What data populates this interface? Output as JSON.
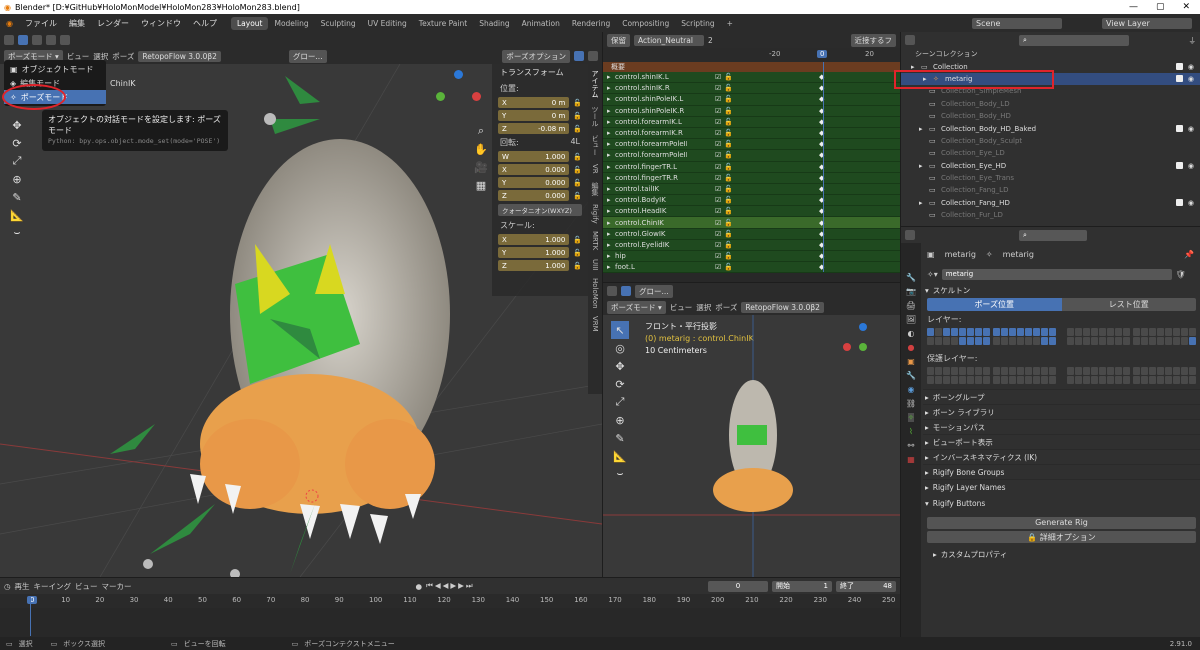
{
  "window": {
    "title": "Blender* [D:¥GitHub¥HoloMonModel¥HoloMon283¥HoloMon283.blend]"
  },
  "menu": {
    "items": [
      "ファイル",
      "編集",
      "レンダー",
      "ウィンドウ",
      "ヘルプ"
    ]
  },
  "workspaces": [
    "Layout",
    "Modeling",
    "Sculpting",
    "UV Editing",
    "Texture Paint",
    "Shading",
    "Animation",
    "Rendering",
    "Compositing",
    "Scripting"
  ],
  "scene": {
    "label": "Scene",
    "view_layer": "View Layer"
  },
  "viewport_header": {
    "mode": "ポーズモード",
    "view": "ビュー",
    "select": "選択",
    "pose": "ポーズ",
    "addon": "RetopoFlow 3.0.0β2",
    "transform": "グロー...",
    "pose_options": "ポーズオプション"
  },
  "mode_menu": {
    "items": [
      "オブジェクトモード",
      "編集モード",
      "ポーズモード"
    ],
    "bone": "ChinIK"
  },
  "tooltip": {
    "title": "オブジェクトの対話モードを設定します: ポーズモード",
    "python": "Python: bpy.ops.object.mode_set(mode='POSE')"
  },
  "npanel": {
    "header": "トランスフォーム",
    "location_label": "位置:",
    "loc": [
      [
        "X",
        "0 m"
      ],
      [
        "Y",
        "0 m"
      ],
      [
        "Z",
        "-0.08 m"
      ]
    ],
    "rotation_label": "回転:",
    "rot_mode_short": "4L",
    "rot": [
      [
        "W",
        "1.000"
      ],
      [
        "X",
        "0.000"
      ],
      [
        "Y",
        "0.000"
      ],
      [
        "Z",
        "0.000"
      ]
    ],
    "rot_mode": "クォータニオン(WXYZ)",
    "scale_label": "スケール:",
    "scale": [
      [
        "X",
        "1.000"
      ],
      [
        "Y",
        "1.000"
      ],
      [
        "Z",
        "1.000"
      ]
    ],
    "tabs": [
      "アイテム",
      "ツール",
      "ビュー",
      "VR",
      "編集",
      "Rigify",
      "MRTK",
      "UIII",
      "HoloMon",
      "VRM"
    ]
  },
  "action_editor": {
    "mode": "保留",
    "action": "Action_Neutral",
    "users": "2",
    "frame_ticks": [
      "-20",
      "0",
      "20"
    ],
    "filter_label": "近接するフ",
    "summary": "概要",
    "channels": [
      "control.shinIK.L",
      "control.shinIK.R",
      "control.shinPoleIK.L",
      "control.shinPoleIK.R",
      "control.forearmIK.L",
      "control.forearmIK.R",
      "control.forearmPoleIK.L",
      "control.forearmPoleIK.R",
      "control.fingerTR.L",
      "control.fingerTR.R",
      "control.tailIK",
      "control.BodyIK",
      "control.HeadIK",
      "control.ChinIK",
      "control.GlowIK",
      "control.EyelidIK",
      "hip",
      "foot.L"
    ]
  },
  "sub_viewport": {
    "view_name": "フロント・平行投影",
    "object": "(0) metarig : control.ChinIK",
    "scale": "10 Centimeters"
  },
  "outliner": {
    "root": "シーンコレクション",
    "items": [
      {
        "name": "Collection",
        "dim": false
      },
      {
        "name": "metarig",
        "dim": false,
        "selected": true
      },
      {
        "name": "Collection_SimpleMesh",
        "dim": true
      },
      {
        "name": "Collection_Body_LD",
        "dim": true
      },
      {
        "name": "Collection_Body_HD",
        "dim": true
      },
      {
        "name": "Collection_Body_HD_Baked",
        "dim": false
      },
      {
        "name": "Collection_Body_Sculpt",
        "dim": true
      },
      {
        "name": "Collection_Eye_LD",
        "dim": true
      },
      {
        "name": "Collection_Eye_HD",
        "dim": false
      },
      {
        "name": "Collection_Eye_Trans",
        "dim": true
      },
      {
        "name": "Collection_Fang_LD",
        "dim": true
      },
      {
        "name": "Collection_Fang_HD",
        "dim": false
      },
      {
        "name": "Collection_Fur_LD",
        "dim": true
      }
    ]
  },
  "properties": {
    "object": "metarig",
    "data": "metarig",
    "datablock": "metarig",
    "skeleton": "スケルトン",
    "pose_position": "ポーズ位置",
    "rest_position": "レスト位置",
    "layers_label": "レイヤー:",
    "protected_label": "保護レイヤー:",
    "sections": [
      "ボーングループ",
      "ボーン ライブラリ",
      "モーションパス",
      "ビューポート表示",
      "インバースキネマティクス (IK)",
      "Rigify Bone Groups",
      "Rigify Layer Names"
    ],
    "rigify_buttons": "Rigify Buttons",
    "generate": "Generate Rig",
    "advanced": "詳細オプション",
    "custom_props": "カスタムプロパティ"
  },
  "timeline": {
    "playback": "再生",
    "keying": "キーイング",
    "view": "ビュー",
    "marker": "マーカー",
    "current": "0",
    "start_label": "開始",
    "start": "1",
    "end_label": "終了",
    "end": "48",
    "ticks": [
      "0",
      "10",
      "20",
      "30",
      "40",
      "50",
      "60",
      "70",
      "80",
      "90",
      "100",
      "110",
      "120",
      "130",
      "140",
      "150",
      "160",
      "170",
      "180",
      "190",
      "200",
      "210",
      "220",
      "230",
      "240",
      "250"
    ]
  },
  "statusbar": {
    "select": "選択",
    "box": "ボックス選択",
    "rotate": "ビューを回転",
    "context": "ポーズコンテクストメニュー",
    "version": "2.91.0"
  }
}
